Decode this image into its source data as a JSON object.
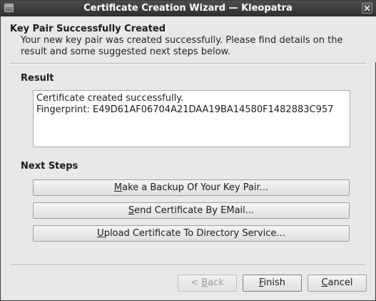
{
  "window": {
    "title": "Certificate Creation Wizard — Kleopatra"
  },
  "header": {
    "title": "Key Pair Successfully Created",
    "subtitle": "Your new key pair was created successfully. Please find details on the result and some suggested next steps below."
  },
  "result": {
    "label": "Result",
    "line1": "Certificate created successfully.",
    "line2": "Fingerprint: E49D61AF06704A21DAA19BA14580F1482883C957"
  },
  "next_steps": {
    "label": "Next Steps",
    "backup": {
      "mnemonic": "M",
      "rest": "ake a Backup Of Your Key Pair..."
    },
    "email": {
      "mnemonic": "S",
      "rest": "end Certificate By EMail..."
    },
    "upload": {
      "mnemonic": "U",
      "rest": "pload Certificate To Directory Service..."
    }
  },
  "buttons": {
    "back": {
      "prefix": "< ",
      "mnemonic": "B",
      "rest": "ack",
      "enabled": false
    },
    "finish": {
      "mnemonic": "F",
      "rest": "inish"
    },
    "cancel": {
      "mnemonic": "C",
      "rest": "ancel"
    }
  },
  "icons": {
    "window_icon": "window-menu-icon",
    "close": "close-icon"
  }
}
